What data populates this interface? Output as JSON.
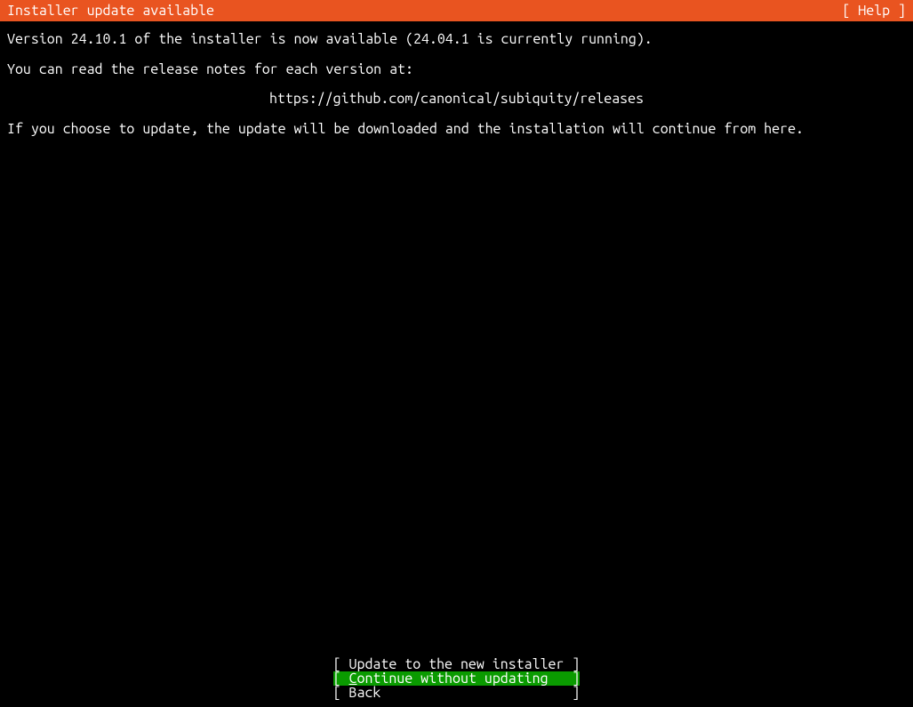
{
  "header": {
    "title": "Installer update available",
    "help": "[ Help ]"
  },
  "content": {
    "line1": "Version 24.10.1 of the installer is now available (24.04.1 is currently running).",
    "line2": "You can read the release notes for each version at:",
    "url": "https://github.com/canonical/subiquity/releases",
    "line3": "If you choose to update, the update will be downloaded and the installation will continue from here."
  },
  "footer": {
    "update_button": "[ Update to the new installer ]",
    "continue_prefix": "[ ",
    "continue_hotkey": "C",
    "continue_rest": "ontinue without updating   ]",
    "back_button": "[ Back                        ]"
  }
}
